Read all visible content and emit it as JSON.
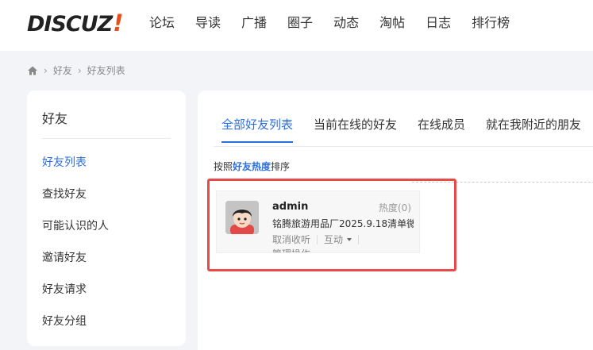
{
  "header": {
    "logo_text": "DISCUZ",
    "logo_mark": "!",
    "nav": [
      "论坛",
      "导读",
      "广播",
      "圈子",
      "动态",
      "淘帖",
      "日志",
      "排行榜"
    ]
  },
  "breadcrumb": {
    "home_icon": "home-icon",
    "separator": "›",
    "items": [
      "好友",
      "好友列表"
    ]
  },
  "sidebar": {
    "title": "好友",
    "items": [
      "好友列表",
      "查找好友",
      "可能认识的人",
      "邀请好友",
      "好友请求",
      "好友分组"
    ],
    "active_index": 0
  },
  "main": {
    "tabs": [
      "全部好友列表",
      "当前在线的好友",
      "在线成员",
      "就在我附近的朋友"
    ],
    "active_tab": 0,
    "sort": {
      "prefix": "按照",
      "key": "好友热度",
      "suffix": "排序"
    },
    "friends": [
      {
        "name": "admin",
        "heat": "热度(0)",
        "description": "铭腾旅游用品厂2025.9.18清单微",
        "actions": {
          "unfollow": "取消收听",
          "interact": "互动",
          "manage": "管理操作"
        }
      }
    ]
  },
  "colors": {
    "accent": "#2b6ee2",
    "logo_mark": "#e94d19",
    "highlight": "#e84a4a"
  }
}
